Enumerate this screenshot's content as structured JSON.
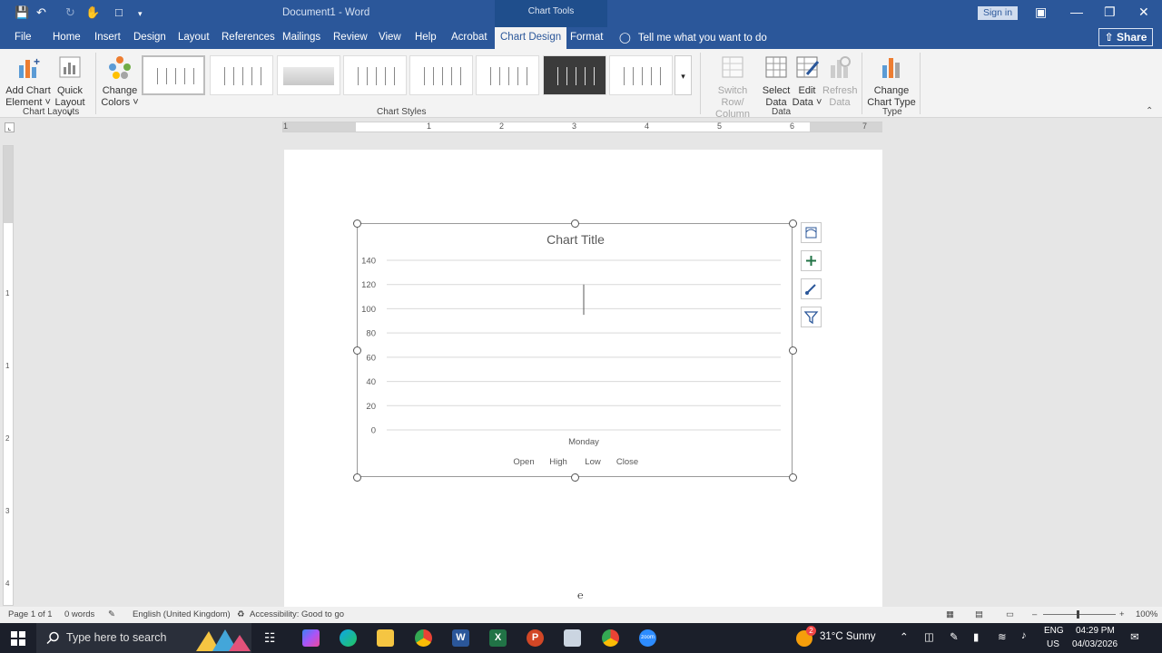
{
  "titlebar": {
    "doc_title": "Document1 - Word",
    "context_title": "Chart Tools",
    "signin": "Sign in"
  },
  "tabs": [
    "File",
    "Home",
    "Insert",
    "Design",
    "Layout",
    "References",
    "Mailings",
    "Review",
    "View",
    "Help",
    "Acrobat",
    "Chart Design",
    "Format"
  ],
  "active_tab": "Chart Design",
  "tell_me": "Tell me what you want to do",
  "share": "Share",
  "ribbon": {
    "add_chart_element": [
      "Add Chart",
      "Element"
    ],
    "quick_layout": [
      "Quick",
      "Layout"
    ],
    "change_colors": [
      "Change",
      "Colors"
    ],
    "switch_row_column": [
      "Switch Row/",
      "Column"
    ],
    "select_data": [
      "Select",
      "Data"
    ],
    "edit_data": [
      "Edit",
      "Data"
    ],
    "refresh_data": [
      "Refresh",
      "Data"
    ],
    "change_chart_type": [
      "Change",
      "Chart Type"
    ],
    "groups": {
      "chart_layouts": "Chart Layouts",
      "chart_styles": "Chart Styles",
      "data": "Data",
      "type": "Type"
    }
  },
  "ruler": {
    "numbers": [
      "1",
      "1",
      "2",
      "3",
      "4",
      "5",
      "6",
      "7"
    ]
  },
  "vruler": {
    "numbers": [
      "1",
      "1",
      "2",
      "3",
      "4",
      "5"
    ]
  },
  "chart_data": {
    "type": "stock",
    "title": "Chart Title",
    "categories": [
      "Monday"
    ],
    "series": [
      {
        "name": "Open",
        "values": [
          105
        ]
      },
      {
        "name": "High",
        "values": [
          120
        ]
      },
      {
        "name": "Low",
        "values": [
          95
        ]
      },
      {
        "name": "Close",
        "values": [
          115
        ]
      }
    ],
    "ylim": [
      0,
      140
    ],
    "yticks": [
      "0",
      "20",
      "40",
      "60",
      "80",
      "100",
      "120",
      "140"
    ],
    "grid": true,
    "legend_position": "bottom"
  },
  "statusbar": {
    "page": "Page 1 of 1",
    "words": "0 words",
    "language": "English (United Kingdom)",
    "accessibility": "Accessibility: Good to go",
    "zoom": "100%"
  },
  "taskbar": {
    "search_placeholder": "Type here to search",
    "weather": "31°C  Sunny",
    "weather_badge": "2",
    "lang": "ENG",
    "region": "US",
    "time": "04:29 PM",
    "date": "04/03/2026"
  },
  "colors": {
    "word_blue": "#2b579a",
    "ribbon_bg": "#f3f3f3",
    "taskbar": "#1b1f2a"
  }
}
